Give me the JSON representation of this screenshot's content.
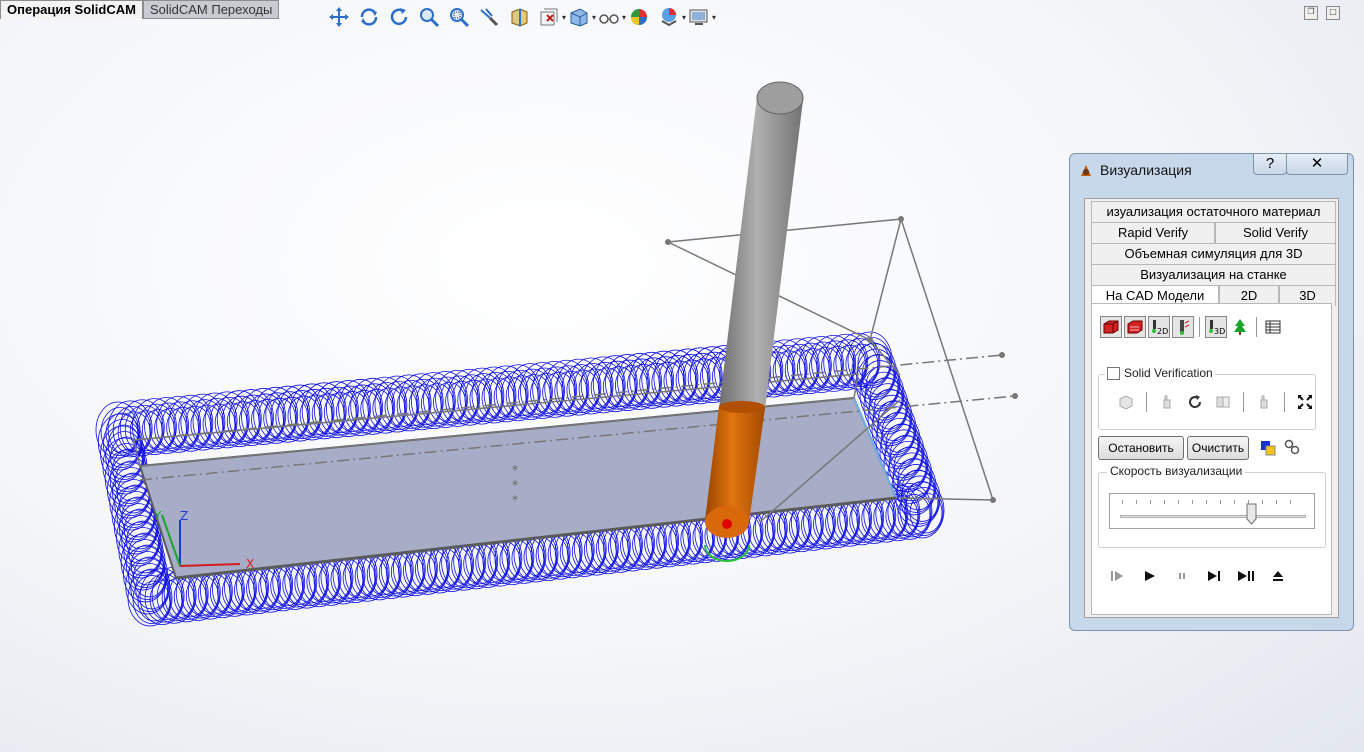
{
  "top_tabs": [
    {
      "label": "Операция  SolidCAM",
      "active": true
    },
    {
      "label": "SolidCAM Переходы",
      "active": false
    }
  ],
  "toolbar_icons": [
    "move-icon",
    "rotate-icon",
    "refresh-icon",
    "zoom-icon",
    "zoom-area-icon",
    "section-view-icon",
    "view-3d-icon",
    "filter-icon",
    "display-style-icon",
    "hide-show-icon",
    "appearance-icon",
    "scene-icon",
    "settings-icon"
  ],
  "window_controls": [
    "restore-icon",
    "maximize-icon"
  ],
  "dialog": {
    "title": "Визуализация",
    "help_label": "?",
    "close_label": "✕",
    "tab_rows": [
      [
        "изуализация остаточного материал"
      ],
      [
        "Rapid Verify",
        "Solid Verify"
      ],
      [
        "Объемная симуляция для 3D"
      ],
      [
        "Визуализация на станке"
      ],
      [
        "На  CAD Модели",
        "2D",
        "3D"
      ]
    ],
    "selected_tab": "На  CAD Модели",
    "solid_verification_label": "Solid Verification",
    "solid_verification_checked": false,
    "stop_label": "Остановить",
    "clear_label": "Очистить",
    "speed_label": "Скорость визуализации",
    "speed_level": 0.7
  },
  "axes": {
    "x": "X",
    "y": "Y",
    "z": "Z"
  },
  "colors": {
    "toolpath": "#1010e6",
    "part_face": "#a7adc7",
    "tool_shank": "#8c8c8c",
    "tool_cutter": "#cc5f00",
    "dialog_frame": "#c7d8ea"
  }
}
